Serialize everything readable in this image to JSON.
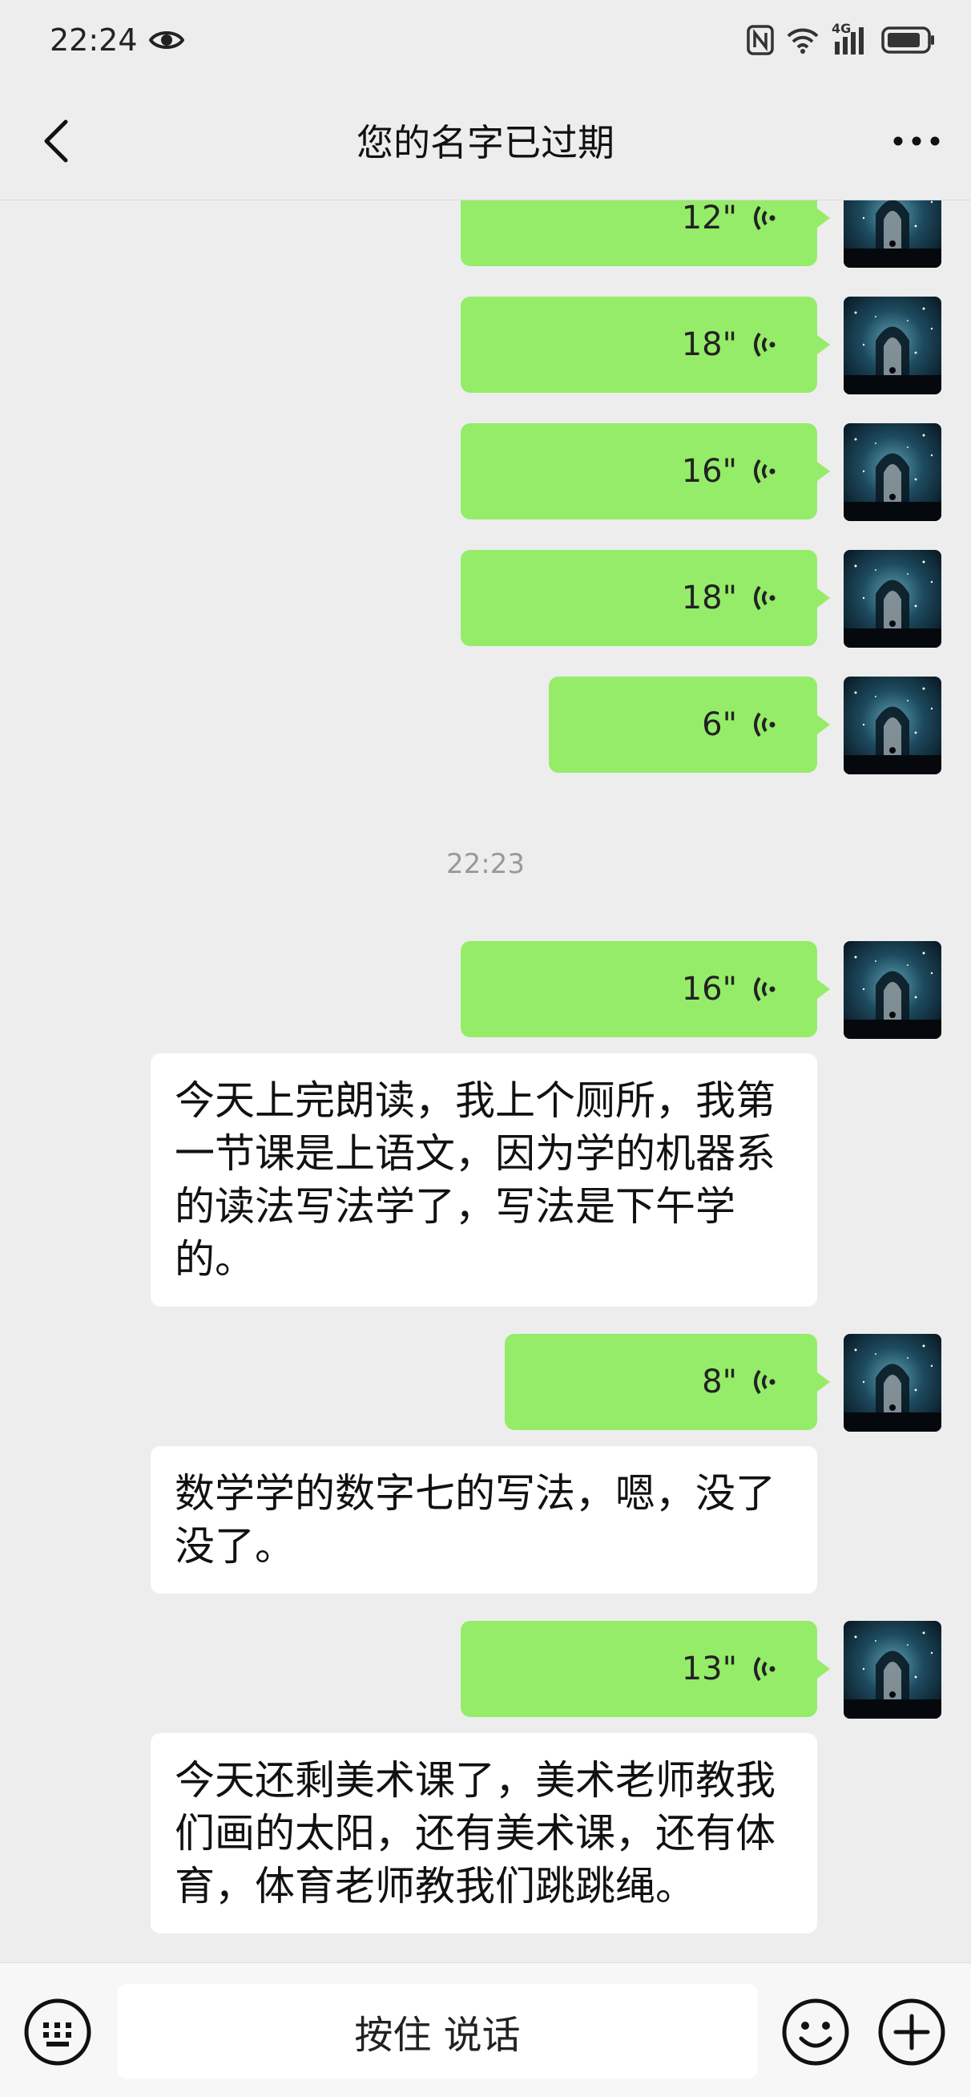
{
  "status_bar": {
    "time": "22:24",
    "icons": [
      "eye-icon",
      "nfc-icon",
      "wifi-icon",
      "4g-signal-icon",
      "battery-icon"
    ],
    "network_label": "4G"
  },
  "nav": {
    "title": "您的名字已过期",
    "back_icon": "chevron-left-icon",
    "more_icon": "more-dots-icon"
  },
  "messages": {
    "voice_1": {
      "duration": "12\""
    },
    "voice_2": {
      "duration": "18\""
    },
    "voice_3": {
      "duration": "16\""
    },
    "voice_4": {
      "duration": "18\""
    },
    "voice_5": {
      "duration": "6\""
    },
    "time_separator": "22:23",
    "voice_6": {
      "duration": "16\""
    },
    "text_6": "今天上完朗读，我上个厕所，我第一节课是上语文，因为学的机器系的读法写法学了，写法是下午学的。",
    "voice_7": {
      "duration": "8\""
    },
    "text_7": "数学学的数字七的写法，嗯，没了没了。",
    "voice_8": {
      "duration": "13\""
    },
    "text_8": "今天还剩美术课了，美术老师教我们画的太阳，还有美术课，还有体育，体育老师教我们跳跳绳。"
  },
  "input_bar": {
    "hold_to_talk": "按住 说话",
    "keyboard_icon": "keyboard-icon",
    "emoji_icon": "emoji-icon",
    "plus_icon": "plus-circle-icon"
  },
  "colors": {
    "background": "#ededed",
    "sent_bubble": "#95ec69",
    "received_bubble": "#ffffff",
    "timestamp": "#999999"
  }
}
